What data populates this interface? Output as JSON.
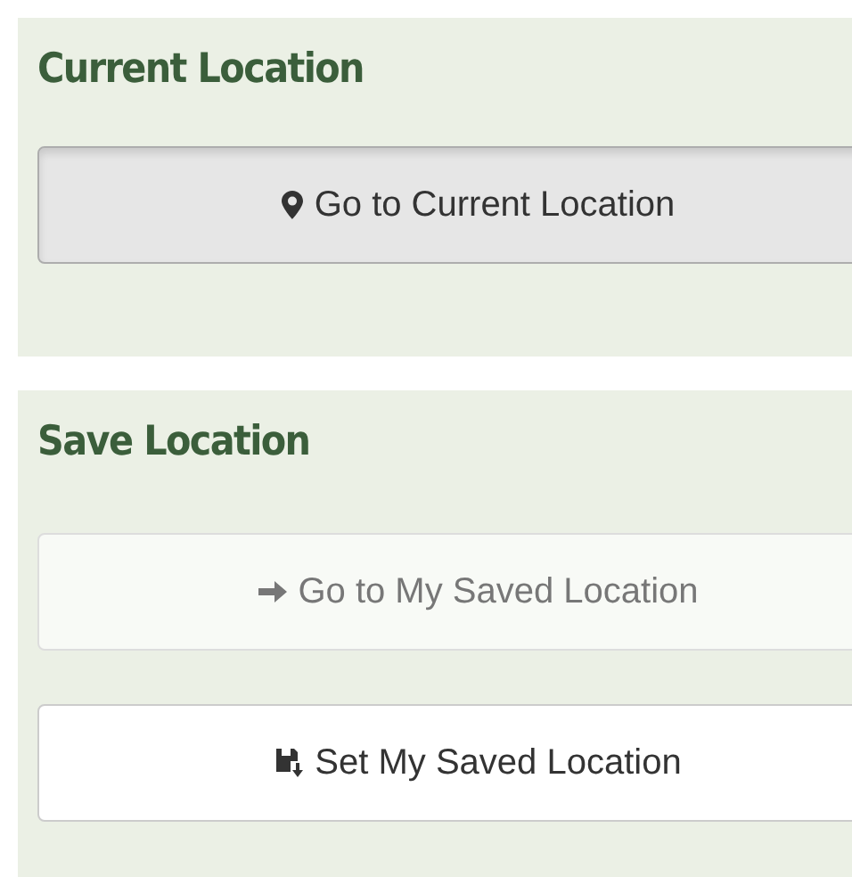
{
  "sections": [
    {
      "title": "Current Location",
      "buttons": [
        {
          "kind": "pin",
          "label": "Go to Current Location",
          "active": true,
          "disabled": false
        }
      ]
    },
    {
      "title": "Save Location",
      "buttons": [
        {
          "kind": "arrow",
          "label": "Go to My Saved Location",
          "active": false,
          "disabled": true
        },
        {
          "kind": "save",
          "label": "Set My Saved Location",
          "active": false,
          "disabled": false
        }
      ]
    }
  ]
}
